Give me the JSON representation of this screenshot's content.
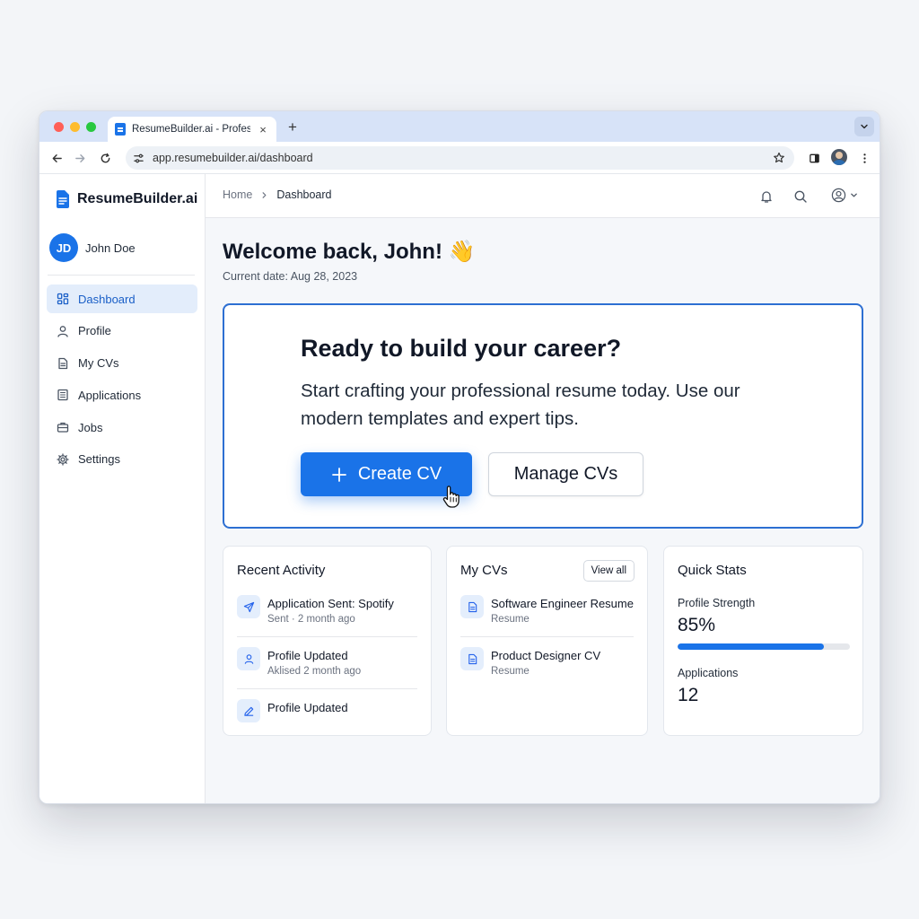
{
  "browser": {
    "tab_title": "ResumeBuilder.ai - Professio",
    "url": "app.resumebuilder.ai/dashboard"
  },
  "app": {
    "brand": "ResumeBuilder.ai",
    "user": {
      "initials": "JD",
      "name": "John Doe"
    },
    "nav": [
      {
        "label": "Dashboard",
        "icon": "grid-icon",
        "active": true
      },
      {
        "label": "Profile",
        "icon": "user-icon"
      },
      {
        "label": "My CVs",
        "icon": "document-icon"
      },
      {
        "label": "Applications",
        "icon": "list-icon"
      },
      {
        "label": "Jobs",
        "icon": "briefcase-icon"
      },
      {
        "label": "Settings",
        "icon": "gear-icon"
      }
    ],
    "accent": "#1a73e8"
  },
  "breadcrumb": {
    "home": "Home",
    "current": "Dashboard"
  },
  "header": {
    "welcome": "Welcome back, John! 👋",
    "date": "Current date: Aug 28, 2023"
  },
  "hero": {
    "title": "Ready to build your career?",
    "text": "Start crafting your professional resume today. Use our modern templates and expert tips.",
    "primary_label": "Create CV",
    "secondary_label": "Manage CVs"
  },
  "recent_activity": {
    "title": "Recent Activity",
    "items": [
      {
        "title": "Application Sent: Spotify",
        "sub": "Sent · 2 month ago",
        "icon": "send-icon"
      },
      {
        "title": "Profile Updated",
        "sub": "Aklised 2 month ago",
        "icon": "user-icon"
      },
      {
        "title": "Profile Updated",
        "sub": "",
        "icon": "pencil-icon"
      }
    ]
  },
  "my_cvs": {
    "title": "My CVs",
    "view_all": "View all",
    "items": [
      {
        "title": "Software Engineer Resume",
        "sub": "Resume"
      },
      {
        "title": "Product Designer CV",
        "sub": "Resume"
      }
    ]
  },
  "quick_stats": {
    "title": "Quick Stats",
    "profile_strength_label": "Profile Strength",
    "profile_strength_value": "85%",
    "profile_strength_fraction": 0.85,
    "applications_label": "Applications",
    "applications_value": "12"
  }
}
